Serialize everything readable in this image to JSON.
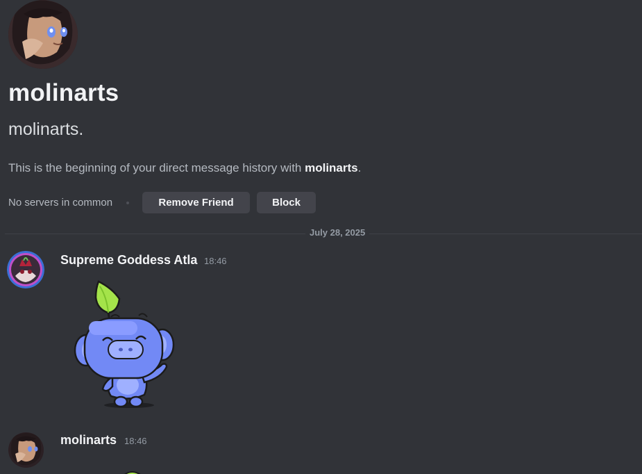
{
  "profile": {
    "display_name": "molinarts",
    "username": "molinarts.",
    "intro_prefix": "This is the beginning of your direct message history with ",
    "intro_name": "molinarts",
    "intro_suffix": ".",
    "mutual_servers": "No servers in common",
    "remove_friend_label": "Remove Friend",
    "block_label": "Block"
  },
  "divider": {
    "date": "July 28, 2025"
  },
  "messages": [
    {
      "author": "Supreme Goddess Atla",
      "time": "18:46",
      "content_type": "sticker",
      "sticker_icon": "wumpus-sprout-sticker"
    },
    {
      "author": "molinarts",
      "time": "18:46"
    }
  ],
  "colors": {
    "background": "#313338",
    "button_bg": "#43444b",
    "muted_text": "#949ba4",
    "sticker_blue": "#7289f5",
    "leaf_green": "#a4e34a"
  }
}
